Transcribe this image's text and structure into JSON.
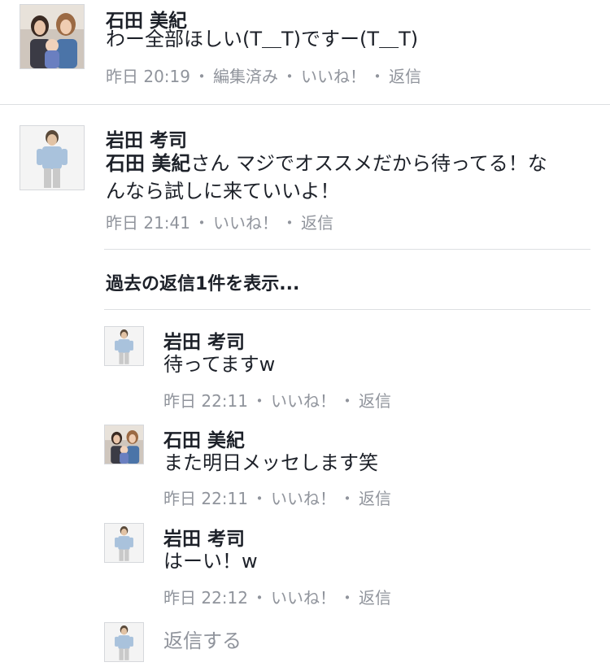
{
  "comments": [
    {
      "author": "石田 美紀",
      "text": "わー全部ほしい(T＿T)ですー(T＿T)",
      "time": "昨日 20:19",
      "edited": "編集済み",
      "like": "いいね！",
      "reply": "返信"
    },
    {
      "author": "岩田 考司",
      "mention": "石田 美紀",
      "text_line1": "さん マジでオススメだから待ってる！な",
      "text_line2": "んなら試しに来ていいよ！",
      "time": "昨日 21:41",
      "like": "いいね！",
      "reply": "返信"
    }
  ],
  "view_previous_replies": "過去の返信1件を表示...",
  "replies": [
    {
      "author": "岩田 考司",
      "text": "待ってますw",
      "time": "昨日 22:11",
      "like": "いいね！",
      "reply": "返信"
    },
    {
      "author": "石田 美紀",
      "text": "また明日メッセします笑",
      "time": "昨日 22:11",
      "like": "いいね！",
      "reply": "返信"
    },
    {
      "author": "岩田 考司",
      "text": "はーい！w",
      "time": "昨日 22:12",
      "like": "いいね！",
      "reply": "返信"
    }
  ],
  "reply_box": {
    "placeholder": "返信する"
  },
  "separator": "・"
}
